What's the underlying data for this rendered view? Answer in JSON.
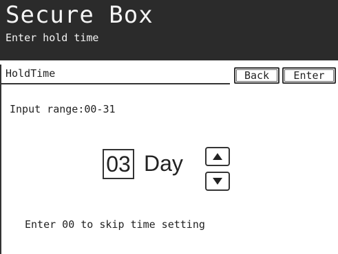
{
  "header": {
    "title": "Secure Box",
    "subtitle": "Enter hold time"
  },
  "toolbar": {
    "label": "HoldTime",
    "back_label": "Back",
    "enter_label": "Enter"
  },
  "content": {
    "range_text": "Input range:00-31",
    "value": "03",
    "unit": "Day",
    "note": "Enter 00 to skip time setting"
  },
  "icons": {
    "up": "arrow-up-icon",
    "down": "arrow-down-icon"
  },
  "colors": {
    "header_bg": "#2b2b2b",
    "header_text": "#f4f4f4",
    "border": "#333333"
  }
}
